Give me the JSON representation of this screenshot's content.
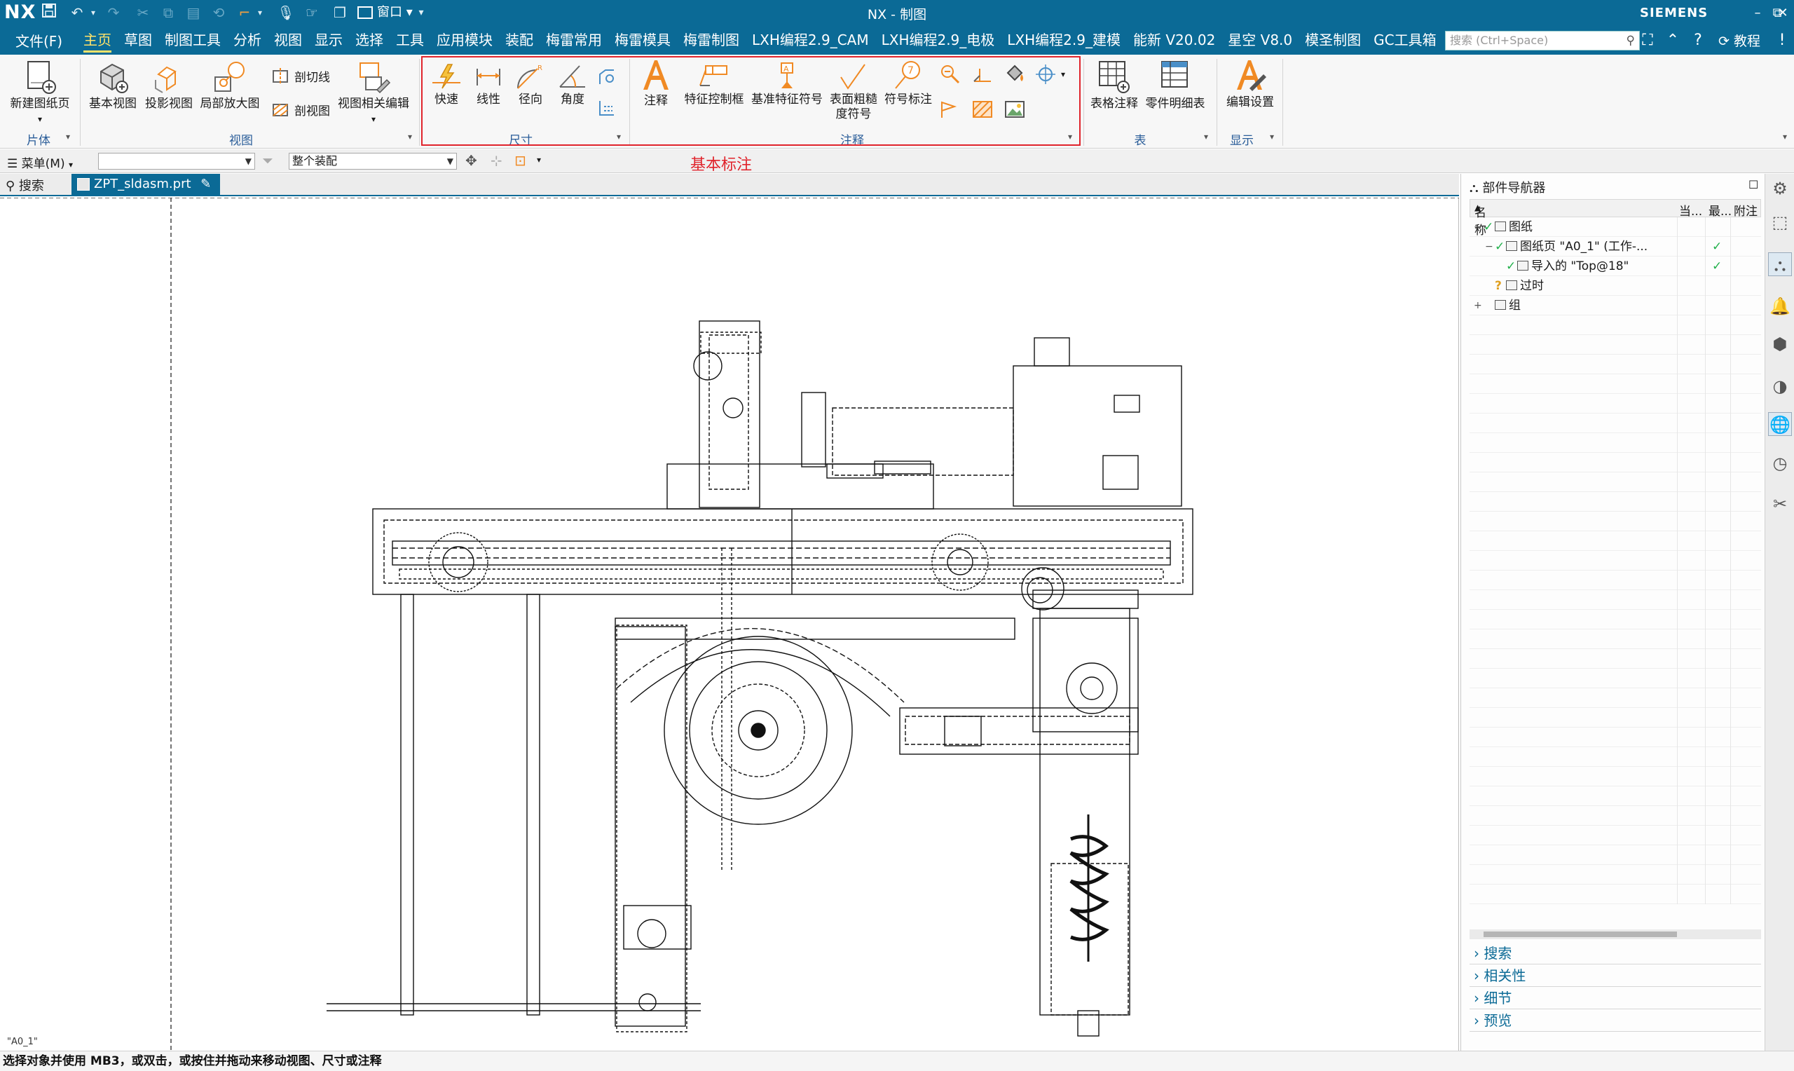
{
  "app": {
    "logo": "NX",
    "window_title": "NX - 制图",
    "window_menu": "窗口",
    "brand": "SIEMENS",
    "tutorial": "教程"
  },
  "menu": {
    "file": "文件(F)",
    "tabs": [
      "主页",
      "草图",
      "制图工具",
      "分析",
      "视图",
      "显示",
      "选择",
      "工具",
      "应用模块",
      "装配",
      "梅雷常用",
      "梅雷模具",
      "梅雷制图",
      "LXH编程2.9_CAM",
      "LXH编程2.9_电极",
      "LXH编程2.9_建模",
      "能新 V20.02",
      "星空 V8.0",
      "模圣制图",
      "GC工具箱"
    ],
    "active_tab": "主页",
    "search_placeholder": "搜索 (Ctrl+Space)"
  },
  "ribbon": {
    "new_sheet": "新建图纸页",
    "base_view": "基本视图",
    "projected_view": "投影视图",
    "detail_view": "局部放大图",
    "section_line": "剖切线",
    "section_view": "剖视图",
    "view_edit": "视图相关编辑",
    "quick": "快速",
    "linear": "线性",
    "radial": "径向",
    "angular": "角度",
    "note": "注释",
    "fcf": "特征控制框",
    "datum_feature": "基准特征符号",
    "surface_finish_1": "表面粗糙",
    "surface_finish_2": "度符号",
    "symbol_callout": "符号标注",
    "table_note": "表格注释",
    "parts_list": "零件明细表",
    "edit_settings": "编辑设置",
    "groups": {
      "sheet": "片体",
      "view": "视图",
      "dimension": "尺寸",
      "annotation": "注释",
      "table": "表",
      "display": "显示"
    }
  },
  "topbar": {
    "menu": "菜单(M)",
    "filter_value": "",
    "scope_value": "整个装配",
    "annotation_label": "基本标注"
  },
  "tabs": {
    "search": "搜索",
    "file": "ZPT_sldasm.prt"
  },
  "canvas": {
    "sheet_label": "\"A0_1\""
  },
  "navigator": {
    "title": "部件导航器",
    "columns": [
      "名称",
      "当...",
      "最...",
      "附注"
    ],
    "rows": [
      {
        "label": "图纸",
        "indent": 0,
        "expand": "−",
        "checked": true,
        "latest": false
      },
      {
        "label": "图纸页 \"A0_1\" (工作-...",
        "indent": 1,
        "expand": "−",
        "checked": true,
        "latest": true
      },
      {
        "label": "导入的 \"Top@18\"",
        "indent": 2,
        "expand": "",
        "checked": true,
        "latest": true
      },
      {
        "label": "过时",
        "indent": 1,
        "expand": "",
        "checked": false,
        "latest": false
      },
      {
        "label": "组",
        "indent": 0,
        "expand": "+",
        "checked": false,
        "latest": false
      }
    ],
    "sections": [
      "搜索",
      "相关性",
      "细节",
      "预览"
    ]
  },
  "status": {
    "text": "选择对象并使用 MB3，或双击，或按住并拖动来移动视图、尺寸或注释"
  },
  "colors": {
    "titlebar": "#0b6a96",
    "accent_orange": "#f08a24",
    "highlight_red": "#e0242c",
    "check_green": "#22b14c"
  }
}
